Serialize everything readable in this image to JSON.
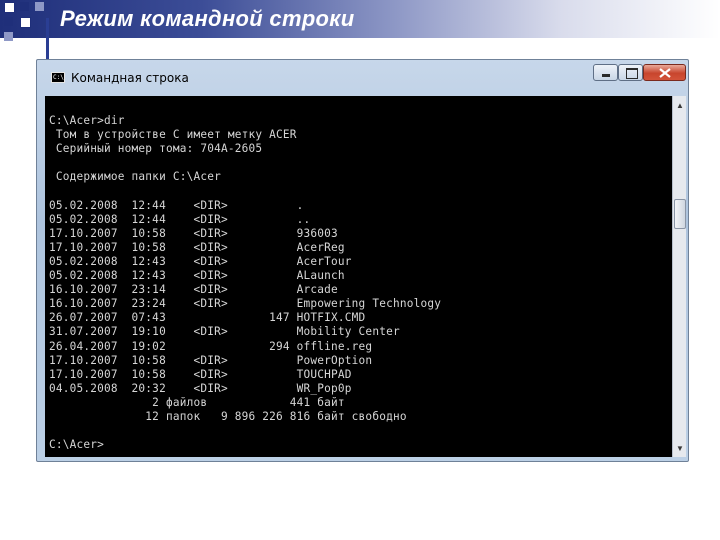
{
  "slide": {
    "title": "Режим командной строки"
  },
  "window": {
    "title": "Командная строка",
    "icon_label": "C:\\",
    "controls": [
      "minimize",
      "maximize",
      "close"
    ]
  },
  "console": {
    "lines": [
      "C:\\Acer>dir",
      " Том в устройстве C имеет метку ACER",
      " Серийный номер тома: 704A-2605",
      "",
      " Содержимое папки C:\\Acer",
      "",
      "05.02.2008  12:44    <DIR>          .",
      "05.02.2008  12:44    <DIR>          ..",
      "17.10.2007  10:58    <DIR>          936003",
      "17.10.2007  10:58    <DIR>          AcerReg",
      "05.02.2008  12:43    <DIR>          AcerTour",
      "05.02.2008  12:43    <DIR>          ALaunch",
      "16.10.2007  23:14    <DIR>          Arcade",
      "16.10.2007  23:24    <DIR>          Empowering Technology",
      "26.07.2007  07:43               147 HOTFIX.CMD",
      "31.07.2007  19:10    <DIR>          Mobility Center",
      "26.04.2007  19:02               294 offline.reg",
      "17.10.2007  10:58    <DIR>          PowerOption",
      "17.10.2007  10:58    <DIR>          TOUCHPAD",
      "04.05.2008  20:32    <DIR>          WR_Pop0p",
      "               2 файлов            441 байт",
      "              12 папок   9 896 226 816 байт свободно",
      "",
      "C:\\Acer>"
    ]
  },
  "colors": {
    "console_bg": "#000000",
    "console_text": "#d6d6d6",
    "slide_header": "#1f2f7a"
  }
}
